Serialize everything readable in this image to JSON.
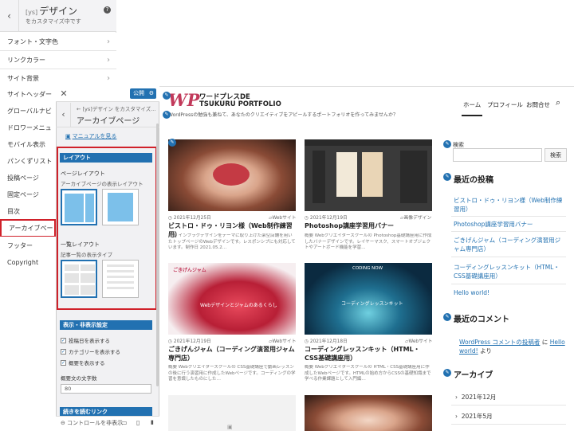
{
  "back_panel": {
    "title_prefix": "[ys]",
    "title": "デザイン",
    "subtitle": "をカスタマイズ中です",
    "items": [
      {
        "label": "フォント・文字色"
      },
      {
        "label": "リンクカラー"
      },
      {
        "label": "サイト背景"
      },
      {
        "label": "サイトヘッダー"
      },
      {
        "label": "グローバルナビゲー"
      },
      {
        "label": "ドロワーメニュー"
      },
      {
        "label": "モバイル表示"
      },
      {
        "label": "パンくずリスト"
      },
      {
        "label": "投稿ページ"
      },
      {
        "label": "固定ページ"
      },
      {
        "label": "目次"
      },
      {
        "label": "アーカイブページ"
      },
      {
        "label": "フッター"
      },
      {
        "label": "Copyright"
      }
    ]
  },
  "front_panel": {
    "publish_label": "公開",
    "breadcrumb": "← [ys]デザイン をカスタマイズ...",
    "title": "アーカイブページ",
    "manual_link": "マニュアルを見る",
    "layout_section": "レイアウト",
    "page_layout_label": "ページレイアウト",
    "page_layout_desc": "アーカイブページの表示レイアウト",
    "list_layout_label": "一覧レイアウト",
    "list_layout_desc": "記事一覧の表示タイプ",
    "display_section": "表示・非表示設定",
    "checks": [
      {
        "label": "投稿日を表示する",
        "checked": true
      },
      {
        "label": "カテゴリーを表示する",
        "checked": true
      },
      {
        "label": "概要を表示する",
        "checked": true
      }
    ],
    "excerpt_label": "概要文の文字数",
    "excerpt_value": "80",
    "more_section": "続きを読むリンク",
    "hide_controls": "コントロールを非表示"
  },
  "site": {
    "logo_mark": "WP",
    "logo_line1": "ワードプレスDE",
    "logo_line2": "TSUKURU PORTFOLIO",
    "description": "WordPressの勉強も兼ねて、あなたのクリエイティブをアピールするポートフォリオを作ってみませんか？",
    "nav": [
      {
        "label": "ホーム"
      },
      {
        "label": "プロフィール"
      },
      {
        "label": "お問合せ"
      }
    ],
    "cards": [
      {
        "date": "2021年12月25日",
        "category": "Webサイト",
        "title": "ビストロ・ドゥ・リヨン様（Web制作練習用）",
        "excerpt": "概要 インプラクデザインをテーマに取り上げた架空店舗を用いたトップページのWebデザインです。レスポンシブにも対応しています。制作日 2021.05.2…"
      },
      {
        "date": "2021年12月19日",
        "category": "画像デザイン",
        "title": "Photoshop講座学習用バナー",
        "excerpt": "概要 Webクリエイタースクールの Photoshop基礎講座用に作成したバナーデザインです。レイヤーマスク、スマートオブジェクトやアートボード機能を学習…"
      },
      {
        "date": "2021年12月19日",
        "category": "Webサイト",
        "title": "ごきげんジャム（コーディング演習用ジャム専門店）",
        "excerpt": "概要 Webクリエイタースクールの CSS基礎講座で動画レッスンの後に行う演習用に作成したWebページです。コーディングの学習を意識したものにした…"
      },
      {
        "date": "2021年12月18日",
        "category": "Webサイト",
        "title": "コーディングレッスンキット（HTML・CSS基礎講座用）",
        "excerpt": "概要 Webクリエイタースクールの HTML・CSS基礎講座用に作成したWebページです。HTMLの始め方からCSSの基礎知識まで学べる作業課題として入門編…"
      }
    ],
    "card_images": [
      {
        "caption": ""
      },
      {
        "caption": ""
      },
      {
        "caption": "ごきげんジャム",
        "overlay": "Webデザインとジャムのあるくらし"
      },
      {
        "caption": "CODING NOW",
        "overlay": "コーディングレッスンキット"
      }
    ],
    "sidebar": {
      "search_label": "検索",
      "search_button": "検索",
      "recent_posts_title": "最近の投稿",
      "recent_posts": [
        {
          "label": "ビストロ・ドゥ・リヨン様（Web制作練習用）"
        },
        {
          "label": "Photoshop講座学習用バナー"
        },
        {
          "label": "ごきげんジャム（コーディング演習用ジャム専門店）"
        },
        {
          "label": "コーディングレッスンキット（HTML・CSS基礎講座用）"
        },
        {
          "label": "Hello world!"
        }
      ],
      "recent_comments_title": "最近のコメント",
      "comment_author": "WordPress コメントの投稿者",
      "comment_on": "に",
      "comment_post": "Hello world!",
      "comment_tail": "より",
      "archive_title": "アーカイブ",
      "archives": [
        {
          "label": "2021年12月"
        },
        {
          "label": "2021年5月"
        }
      ]
    }
  },
  "colors": {
    "accent": "#2271b1",
    "highlight": "#d0212a",
    "logo": "#c23a5b"
  }
}
